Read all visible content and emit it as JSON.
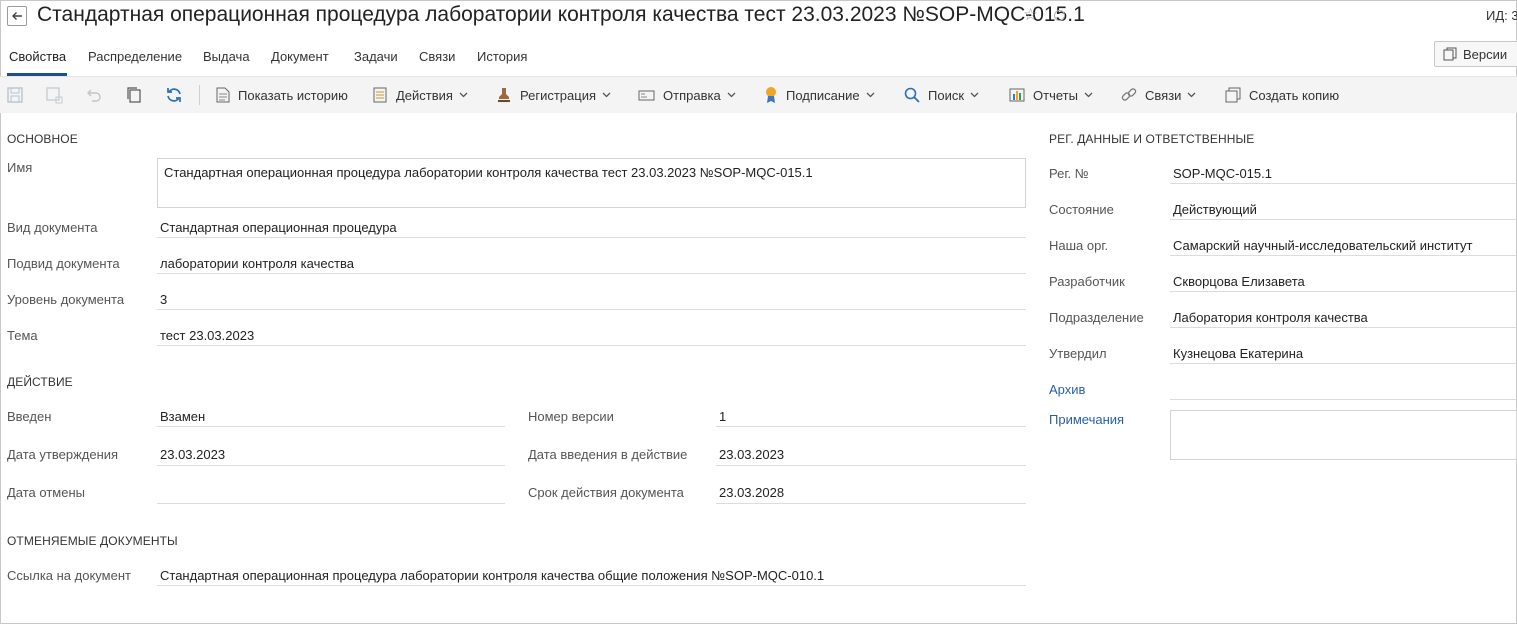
{
  "header": {
    "title": "Стандартная операционная процедура лаборатории контроля качества тест 23.03.2023 №SOP-MQC-015.1",
    "id_label": "ИД: 3"
  },
  "tabs": [
    {
      "label": "Свойства",
      "active": true
    },
    {
      "label": "Распределение"
    },
    {
      "label": "Выдача"
    },
    {
      "label": "Документ"
    },
    {
      "label": "Задачи"
    },
    {
      "label": "Связи"
    },
    {
      "label": "История"
    }
  ],
  "versions_button": {
    "label": "Версии"
  },
  "toolbar": {
    "show_history": "Показать историю",
    "actions": "Действия",
    "registration": "Регистрация",
    "send": "Отправка",
    "signing": "Подписание",
    "search": "Поиск",
    "reports": "Отчеты",
    "links": "Связи",
    "create_copy": "Создать копию"
  },
  "main": {
    "section_main": "ОСНОВНОЕ",
    "name_label": "Имя",
    "name_value": "Стандартная операционная процедура лаборатории контроля качества тест 23.03.2023 №SOP-MQC-015.1",
    "doc_type_label": "Вид документа",
    "doc_type_value": "Стандартная операционная процедура",
    "doc_subtype_label": "Подвид документа",
    "doc_subtype_value": "лаборатории контроля качества",
    "doc_level_label": "Уровень документа",
    "doc_level_value": "3",
    "topic_label": "Тема",
    "topic_value": "тест 23.03.2023",
    "section_action": "ДЕЙСТВИЕ",
    "introduced_label": "Введен",
    "introduced_value": "Взамен",
    "version_no_label": "Номер версии",
    "version_no_value": "1",
    "approval_date_label": "Дата утверждения",
    "approval_date_value": "23.03.2023",
    "effective_date_label": "Дата введения в действие",
    "effective_date_value": "23.03.2023",
    "cancel_date_label": "Дата отмены",
    "cancel_date_value": "",
    "validity_label": "Срок действия документа",
    "validity_value": "23.03.2028",
    "section_canceled": "ОТМЕНЯЕМЫЕ ДОКУМЕНТЫ",
    "doc_link_label": "Ссылка на документ",
    "doc_link_value": "Стандартная операционная процедура лаборатории контроля качества общие положения №SOP-MQC-010.1"
  },
  "side": {
    "section_reg": "РЕГ. ДАННЫЕ И ОТВЕТСТВЕННЫЕ",
    "reg_no_label": "Рег. №",
    "reg_no_value": "SOP-MQC-015.1",
    "state_label": "Состояние",
    "state_value": "Действующий",
    "org_label": "Наша орг.",
    "org_value": "Самарский научный-исследовательский институт",
    "developer_label": "Разработчик",
    "developer_value": "Скворцова Елизавета",
    "department_label": "Подразделение",
    "department_value": "Лаборатория контроля качества",
    "approved_label": "Утвердил",
    "approved_value": "Кузнецова Екатерина",
    "archive_label": "Архив",
    "notes_label": "Примечания"
  },
  "colors": {
    "accent": "#1e4e8c",
    "link": "#2a5ea8",
    "toolbar_bg": "#f4f4f4"
  }
}
